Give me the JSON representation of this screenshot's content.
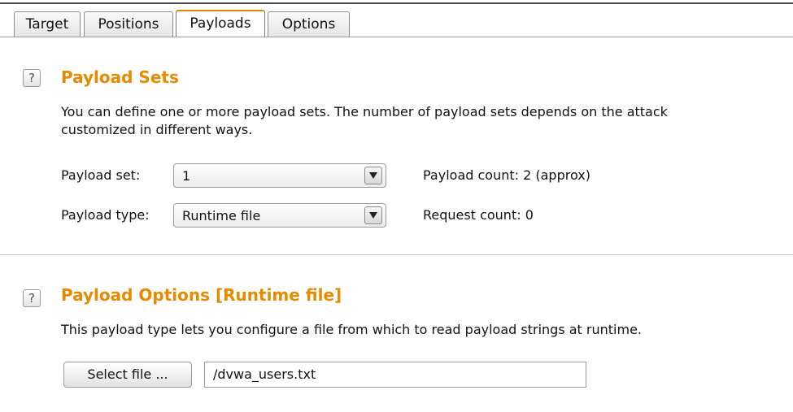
{
  "tabs": [
    {
      "label": "Target",
      "active": false
    },
    {
      "label": "Positions",
      "active": false
    },
    {
      "label": "Payloads",
      "active": true
    },
    {
      "label": "Options",
      "active": false
    }
  ],
  "payload_sets": {
    "help_glyph": "?",
    "title": "Payload Sets",
    "description_line1": "You can define one or more payload sets. The number of payload sets depends on the attack",
    "description_line2": "customized in different ways.",
    "set_label": "Payload set:",
    "set_value": "1",
    "type_label": "Payload type:",
    "type_value": "Runtime file",
    "payload_count": "Payload count:  2 (approx)",
    "request_count": "Request count:  0"
  },
  "payload_options": {
    "help_glyph": "?",
    "title": "Payload Options [Runtime file]",
    "description": "This payload type lets you configure a file from which to read payload strings at runtime.",
    "select_file_label": "Select file ...",
    "file_path": "/dvwa_users.txt"
  },
  "icons": {
    "help": "help-icon",
    "dropdown": "chevron-down-icon"
  },
  "colors": {
    "accent": "#e88a00",
    "active_tab_border": "#e08a00"
  }
}
